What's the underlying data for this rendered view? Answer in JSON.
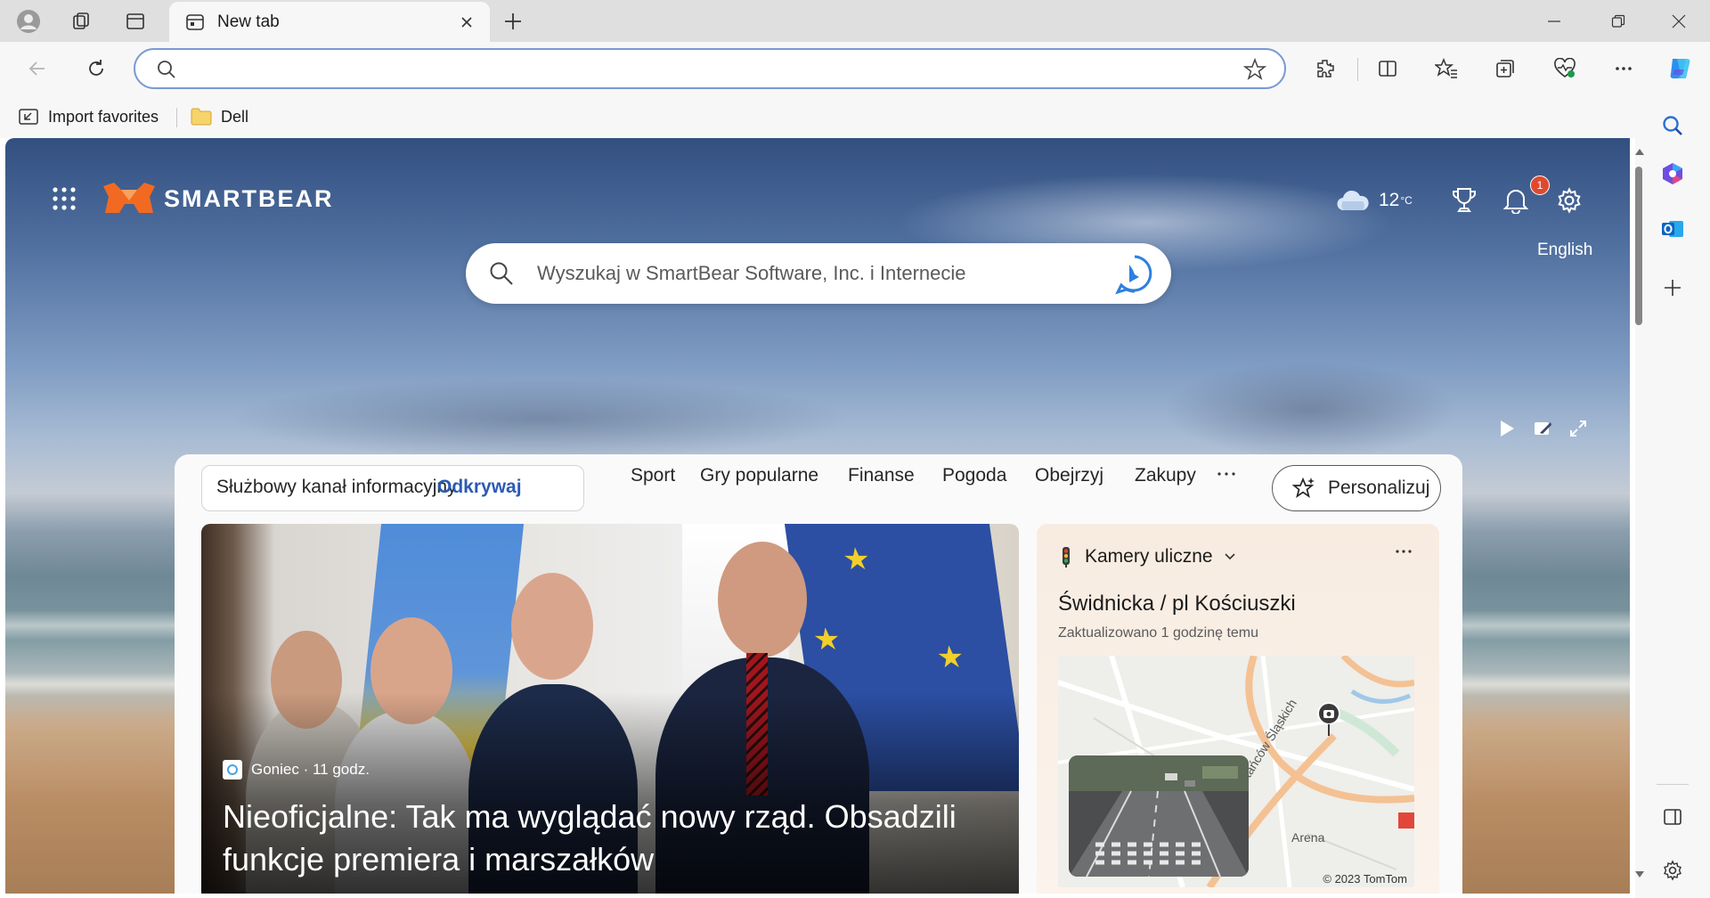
{
  "browser": {
    "tab": {
      "title": "New tab"
    },
    "address_bar": {
      "value": "",
      "placeholder": ""
    },
    "favorites": [
      {
        "label": "Import favorites",
        "icon": "import-icon"
      },
      {
        "label": "Dell",
        "icon": "folder-icon"
      }
    ]
  },
  "page": {
    "brand": "SMARTBEAR",
    "weather": {
      "temperature": "12",
      "unit": "°C",
      "icon": "cloud-icon"
    },
    "notifications_count": "1",
    "language": "English",
    "search": {
      "placeholder": "Wyszukaj w SmartBear Software, Inc. i Internecie"
    }
  },
  "feed": {
    "nav_group": [
      {
        "label": "Służbowy kanał informacyjny",
        "active": false
      },
      {
        "label": "Odkrywaj",
        "active": true
      }
    ],
    "nav": [
      "Sport",
      "Gry popularne",
      "Finanse",
      "Pogoda",
      "Obejrzyj",
      "Zakupy"
    ],
    "more": "···",
    "personalize_label": "Personalizuj",
    "hero": {
      "source": "Goniec · 11 godz.",
      "title": "Nieoficjalne: Tak ma wyglądać nowy rząd. Obsadzili funkcje premiera i marszałków"
    },
    "traffic": {
      "header": "Kamery uliczne",
      "location": "Świdnicka / pl Kościuszki",
      "updated": "Zaktualizowano 1 godzinę temu",
      "map_street": "Powstańców Śląskich",
      "map_area": "Arena",
      "map_copyright": "© 2023 TomTom"
    }
  },
  "colors": {
    "accent": "#2b5bb5",
    "badge": "#e0492e",
    "logo_orange": "#f26a21"
  }
}
